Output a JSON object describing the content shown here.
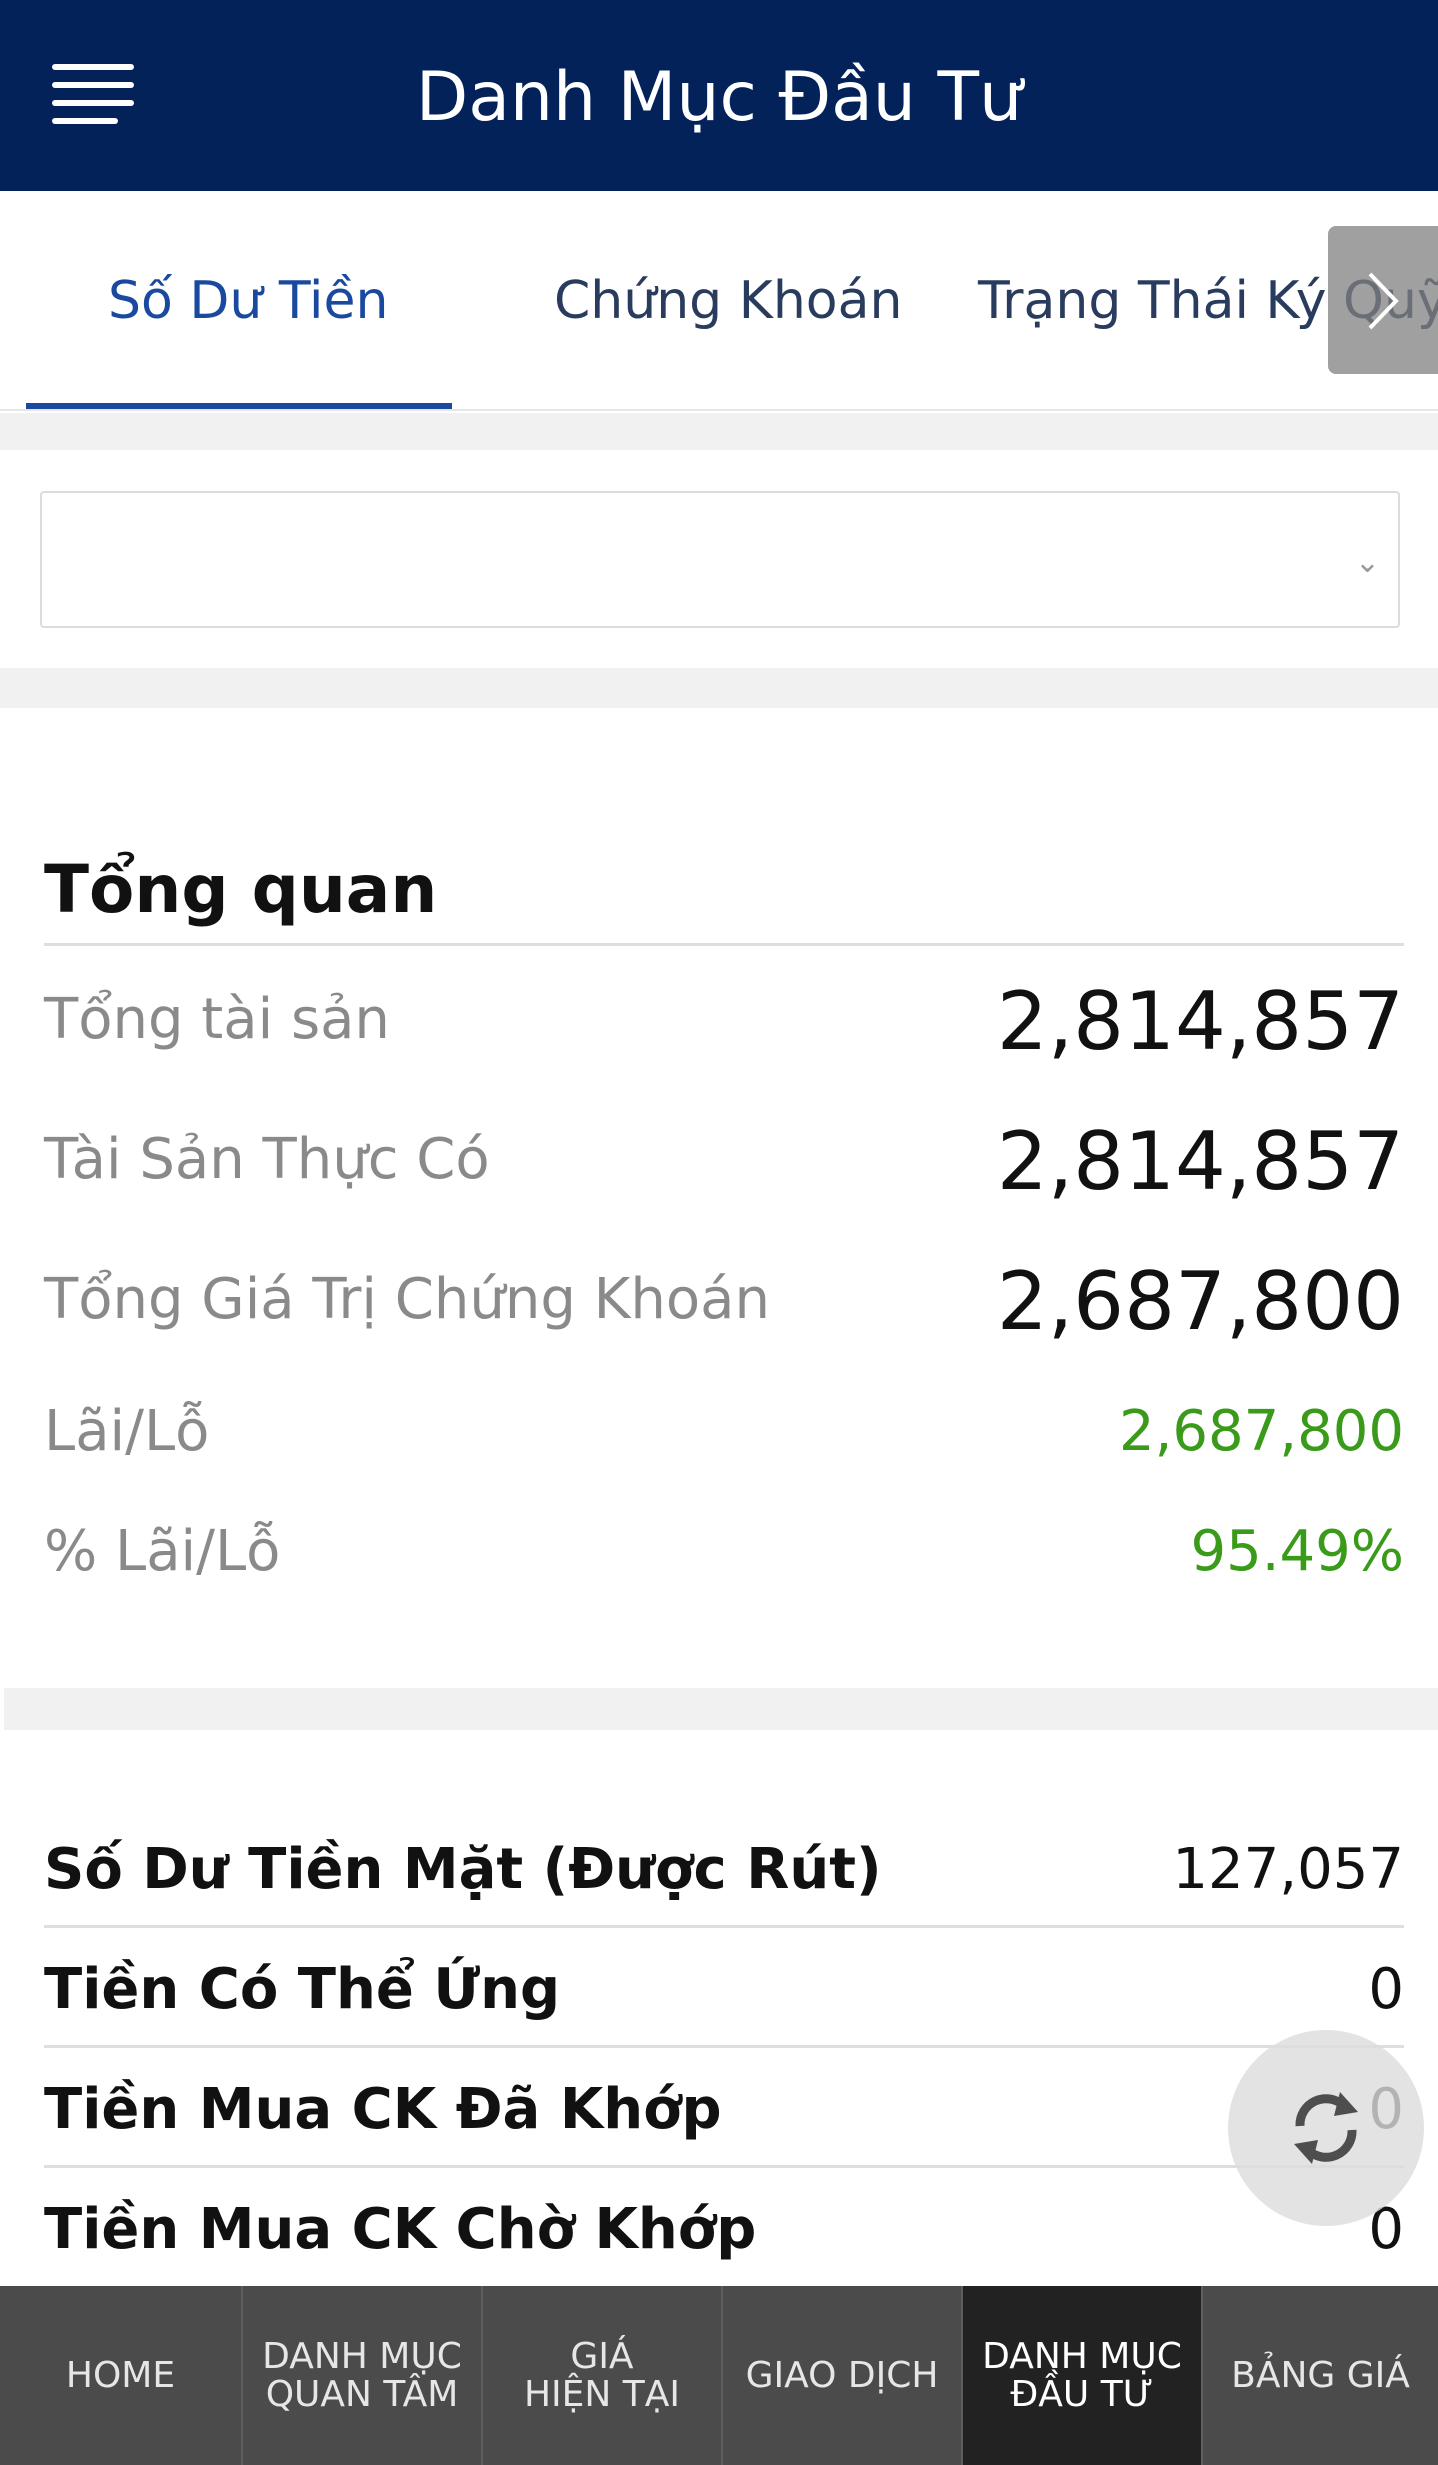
{
  "header": {
    "title": "Danh Mục Đầu Tư",
    "menu_icon": "hamburger-icon"
  },
  "tabs": [
    {
      "label": "Số Dư Tiền",
      "active": true
    },
    {
      "label": "Chứng Khoán",
      "active": false
    },
    {
      "label": "Trạng Thái Ký Quỹ",
      "active": false
    }
  ],
  "account_select": {
    "value": ""
  },
  "overview": {
    "title": "Tổng quan",
    "rows": [
      {
        "label": "Tổng tài sản",
        "value": "2,814,857"
      },
      {
        "label": "Tài Sản Thực Có",
        "value": "2,814,857"
      },
      {
        "label": "Tổng Giá Trị Chứng Khoán",
        "value": "2,687,800"
      },
      {
        "label": "Lãi/Lỗ",
        "value": "2,687,800"
      },
      {
        "label": "% Lãi/Lỗ",
        "value": "95.49%"
      }
    ]
  },
  "cash": {
    "rows": [
      {
        "label": "Số Dư Tiền Mặt (Được Rút)",
        "value": "127,057"
      },
      {
        "label": "Tiền Có Thể Ứng",
        "value": "0"
      },
      {
        "label": "Tiền Mua CK Đã Khớp",
        "value": "0"
      },
      {
        "label": "Tiền Mua CK Chờ Khớp",
        "value": "0"
      }
    ]
  },
  "bottom_nav": [
    {
      "line1": "HOME",
      "line2": ""
    },
    {
      "line1": "DANH MỤC",
      "line2": "QUAN TÂM"
    },
    {
      "line1": "GIÁ",
      "line2": "HIỆN TẠI"
    },
    {
      "line1": "GIAO DỊCH",
      "line2": ""
    },
    {
      "line1": "DANH MỤC",
      "line2": "ĐẦU TƯ"
    },
    {
      "line1": "BẢNG GIÁ",
      "line2": ""
    }
  ],
  "colors": {
    "header_bg": "#03225a",
    "accent": "#1a4aa0",
    "positive": "#3a9a1a",
    "nav_bg": "#4b4b4b",
    "nav_active_bg": "#222222"
  }
}
